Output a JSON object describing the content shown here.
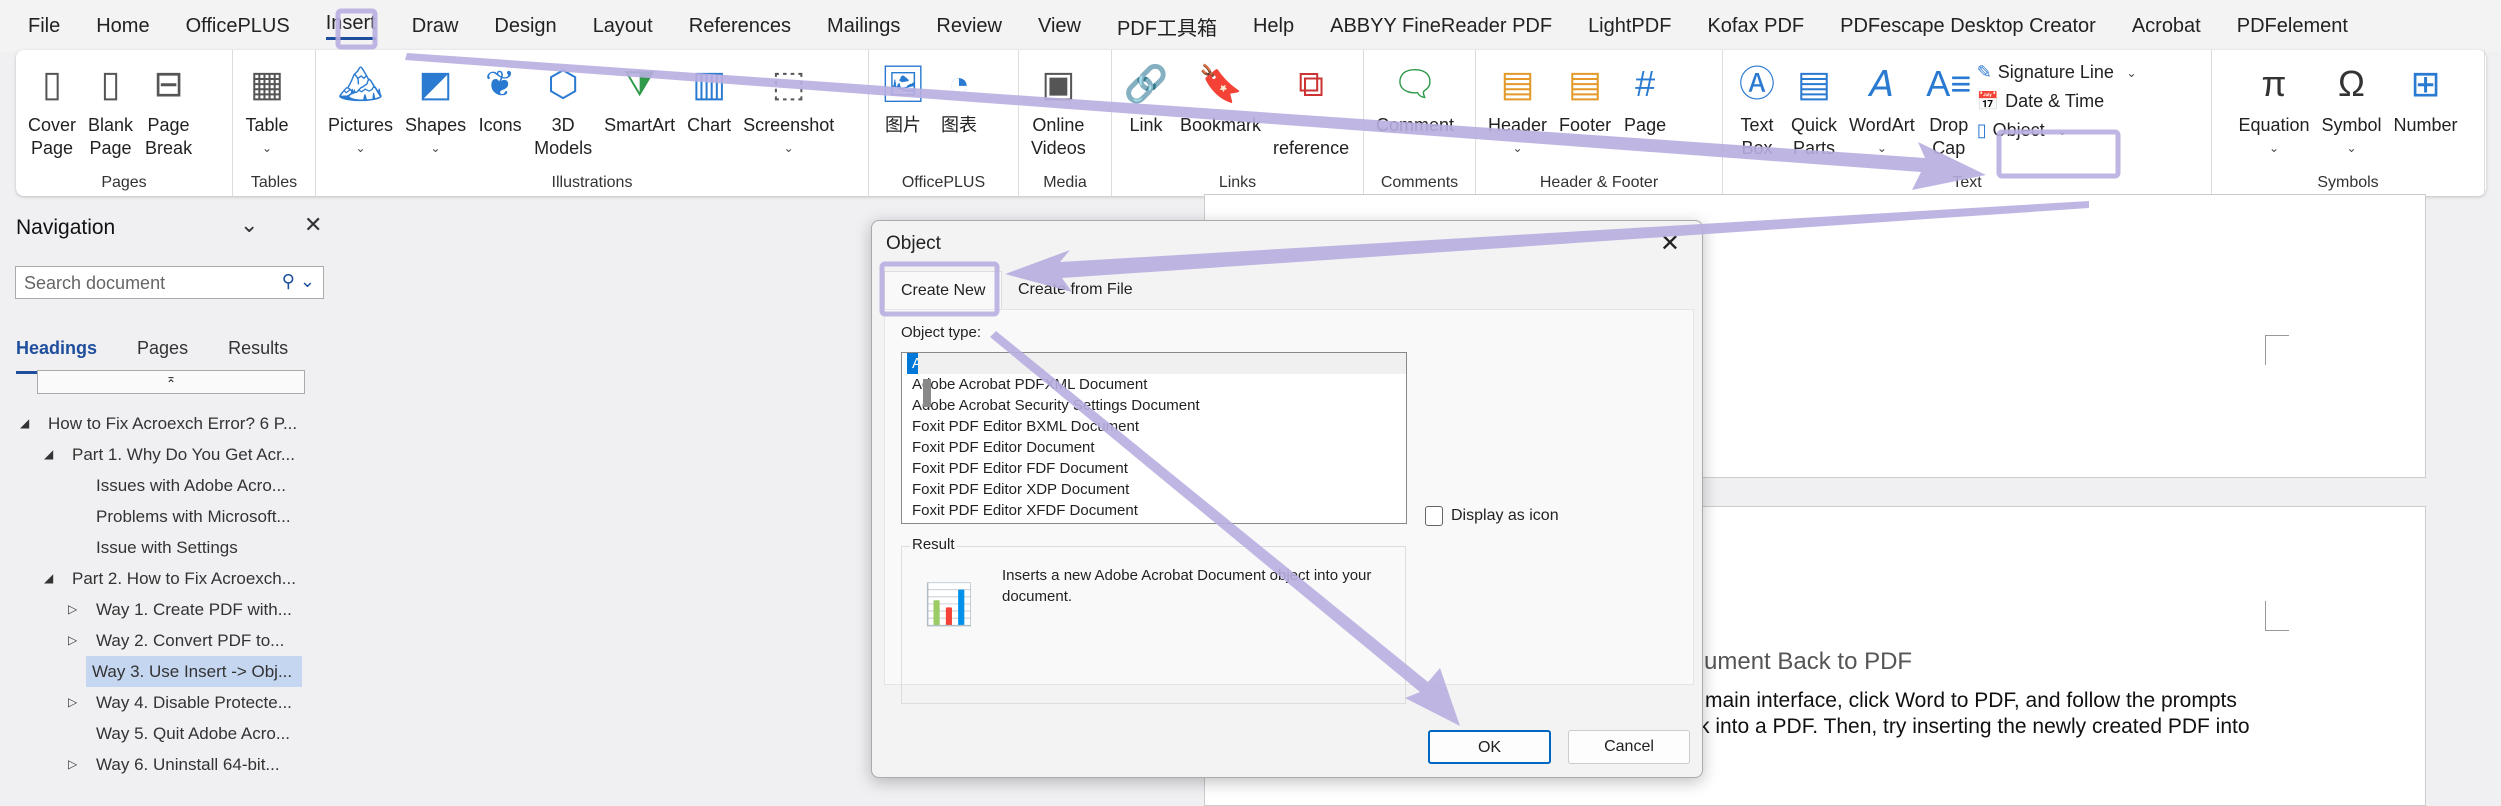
{
  "menubar": [
    "File",
    "Home",
    "OfficePLUS",
    "Insert",
    "Draw",
    "Design",
    "Layout",
    "References",
    "Mailings",
    "Review",
    "View",
    "PDF工具箱",
    "Help",
    "ABBYY FineReader PDF",
    "LightPDF",
    "Kofax PDF",
    "PDFescape Desktop Creator",
    "Acrobat",
    "PDFelement"
  ],
  "active_tab": "Insert",
  "ribbon": {
    "pages": {
      "label": "Pages",
      "cover": "Cover",
      "cover2": "Page",
      "blank": "Blank",
      "blank2": "Page",
      "break": "Page",
      "break2": "Break"
    },
    "tables": {
      "label": "Tables",
      "table": "Table"
    },
    "illustrations": {
      "label": "Illustrations",
      "pictures": "Pictures",
      "shapes": "Shapes",
      "icons": "Icons",
      "models": "3D",
      "models2": "Models",
      "smartart": "SmartArt",
      "chart": "Chart",
      "screenshot": "Screenshot"
    },
    "officeplus": {
      "label": "OfficePLUS",
      "pic": "图片",
      "chart": "图表"
    },
    "media": {
      "label": "Media",
      "online": "Online",
      "videos": "Videos"
    },
    "links": {
      "label": "Links",
      "link": "Link",
      "bookmark": "Bookmark",
      "cross": "reference"
    },
    "comments": {
      "label": "Comments",
      "comment": "Comment"
    },
    "headerfooter": {
      "label": "Header & Footer",
      "header": "Header",
      "footer": "Footer",
      "pagenum": "Page"
    },
    "text": {
      "label": "Text",
      "textbox": "Text",
      "textbox2": "Box",
      "quick": "Quick",
      "quick2": "Parts",
      "wordart": "WordArt",
      "drop": "Drop",
      "drop2": "Cap",
      "signature": "Signature Line",
      "datetime": "Date & Time",
      "object": "Object"
    },
    "symbols": {
      "label": "Symbols",
      "equation": "Equation",
      "symbol": "Symbol",
      "number": "Number"
    }
  },
  "nav": {
    "title": "Navigation",
    "search_placeholder": "Search document",
    "tabs": [
      "Headings",
      "Pages",
      "Results"
    ],
    "items": [
      {
        "text": "How to Fix Acroexch Error? 6 P...",
        "level": 0,
        "toggle": "expanded"
      },
      {
        "text": "Part 1. Why Do You Get Acr...",
        "level": 1,
        "toggle": "expanded"
      },
      {
        "text": "Issues with Adobe Acro...",
        "level": 2,
        "toggle": "none"
      },
      {
        "text": "Problems with Microsoft...",
        "level": 2,
        "toggle": "none"
      },
      {
        "text": "Issue with Settings",
        "level": 2,
        "toggle": "none"
      },
      {
        "text": "Part 2. How to Fix Acroexch...",
        "level": 1,
        "toggle": "expanded"
      },
      {
        "text": "Way 1. Create PDF with...",
        "level": 2,
        "toggle": "collapsed"
      },
      {
        "text": "Way 2. Convert PDF to...",
        "level": 2,
        "toggle": "collapsed"
      },
      {
        "text": "Way 3. Use Insert -> Obj...",
        "level": 2,
        "toggle": "none",
        "selected": true
      },
      {
        "text": "Way 4. Disable Protecte...",
        "level": 2,
        "toggle": "collapsed"
      },
      {
        "text": "Way 5. Quit Adobe Acro...",
        "level": 2,
        "toggle": "none"
      },
      {
        "text": "Way 6. Uninstall 64-bit...",
        "level": 2,
        "toggle": "collapsed"
      }
    ]
  },
  "document": {
    "heading": "ument Back to PDF",
    "line1": "main interface, click Word to PDF, and follow the prompts",
    "line2": "k into a PDF. Then, try inserting the newly created PDF into"
  },
  "dialog": {
    "title": "Object",
    "tabs": [
      "Create New",
      "Create from File"
    ],
    "object_type_label": "Object type:",
    "object_types": [
      "Adobe Acrobat Document",
      "Adobe Acrobat PDFXML Document",
      "Adobe Acrobat Security Settings Document",
      "Foxit PDF Editor BXML Document",
      "Foxit PDF Editor Document",
      "Foxit PDF Editor FDF Document",
      "Foxit PDF Editor XDP Document",
      "Foxit PDF Editor XFDF Document"
    ],
    "selected": "Adobe Acrobat Document",
    "display_as_icon": "Display as icon",
    "display_as_icon_checked": false,
    "result_label": "Result",
    "result_text": "Inserts a new Adobe Acrobat Document object into your document.",
    "ok": "OK",
    "cancel": "Cancel"
  },
  "colors": {
    "accent": "#1f4e9c",
    "selection": "#0078d7",
    "annotation": "#b9aee0"
  }
}
